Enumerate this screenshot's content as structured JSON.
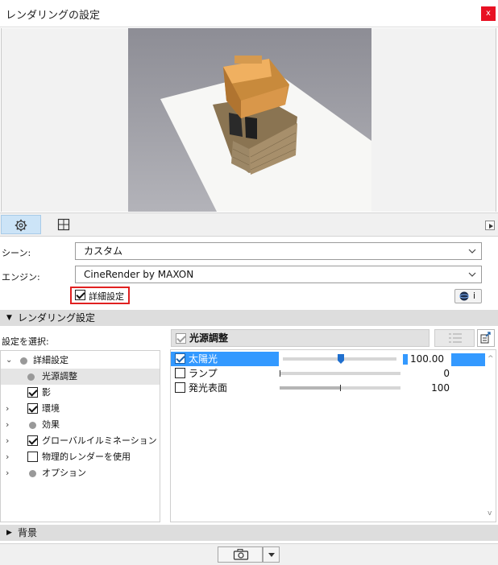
{
  "window": {
    "title": "レンダリングの設定",
    "close_label": "x"
  },
  "scene": {
    "label": "シーン:",
    "value": "カスタム"
  },
  "engine": {
    "label": "エンジン:",
    "value": "CineRender by MAXON"
  },
  "detail_settings": {
    "label": "詳細設定",
    "checked": true
  },
  "info_button": {
    "label": "i"
  },
  "rendering_section": {
    "label": "レンダリング設定"
  },
  "settings_selector": {
    "label": "設定を選択:"
  },
  "tree": {
    "items": [
      {
        "label": "詳細設定",
        "type": "dot",
        "expander": "⌄",
        "level": 0
      },
      {
        "label": "光源調整",
        "type": "dot",
        "expander": "",
        "level": 1,
        "selected": true
      },
      {
        "label": "影",
        "type": "check",
        "checked": true,
        "expander": "",
        "level": 0
      },
      {
        "label": "環境",
        "type": "check",
        "checked": true,
        "expander": ">",
        "level": 0
      },
      {
        "label": "効果",
        "type": "dot",
        "expander": ">",
        "level": 0
      },
      {
        "label": "グローバルイルミネーション",
        "type": "check",
        "checked": true,
        "expander": ">",
        "level": 0
      },
      {
        "label": "物理的レンダーを使用",
        "type": "check",
        "checked": false,
        "expander": ">",
        "level": 0
      },
      {
        "label": "オプション",
        "type": "dot",
        "expander": ">",
        "level": 0
      }
    ]
  },
  "params_header": {
    "label": "光源調整",
    "checked": true
  },
  "params": [
    {
      "name": "太陽光",
      "checked": true,
      "value": "100.00",
      "level": 0.45,
      "selected": true
    },
    {
      "name": "ランプ",
      "checked": false,
      "value": "0",
      "level": 0.0
    },
    {
      "name": "発光表面",
      "checked": false,
      "value": "100",
      "level": 0.5
    }
  ],
  "background_section": {
    "label": "背景"
  },
  "icons": {
    "settings_tab": "gear-icon",
    "view_tab": "grid-view-icon",
    "camera": "camera-icon"
  },
  "colors": {
    "close": "#e81123",
    "selection": "#3399ff",
    "active_tab": "#cce4f7",
    "highlight_border": "#e02020"
  }
}
